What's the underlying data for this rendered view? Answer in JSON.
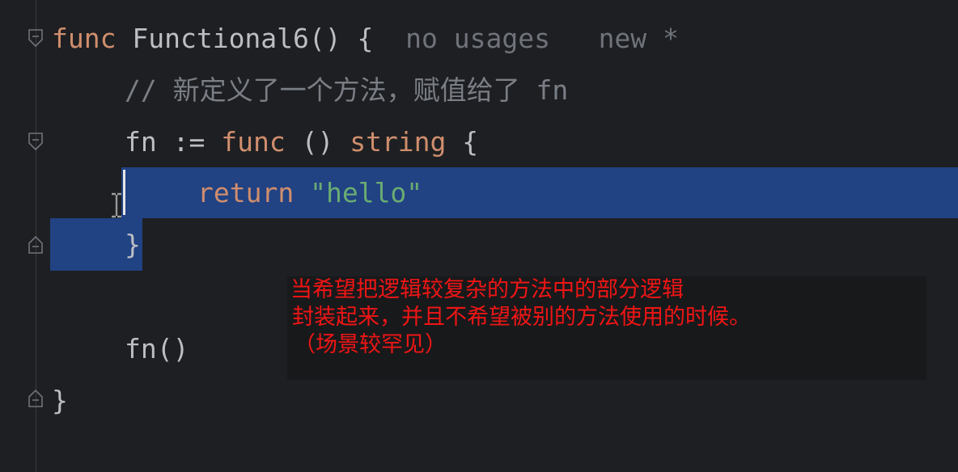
{
  "code": {
    "line1": {
      "keyword": "func",
      "name": "Functional6",
      "rest": "() {",
      "hint_usages": "no usages",
      "hint_new": "new *"
    },
    "line2": {
      "comment": "// 新定义了一个方法，赋值给了 fn"
    },
    "line3": {
      "var": "fn",
      "op": " := ",
      "keyword": "func",
      "parens": " () ",
      "type": "string",
      "brace": " {"
    },
    "line4": {
      "keyword": "return",
      "string": "\"hello\""
    },
    "line5": {
      "brace": "}"
    },
    "line6": {
      "call": "fn()"
    },
    "line7": {
      "brace": "}"
    }
  },
  "annotation": {
    "line1": "当希望把逻辑较复杂的方法中的部分逻辑",
    "line2": "封装起来，并且不希望被别的方法使用的时候。",
    "line3": "（场景较罕见）"
  },
  "colors": {
    "background": "#1e1f22",
    "keyword": "#cf8e6d",
    "string": "#6aab73",
    "comment": "#7a7e85",
    "selection": "#214283",
    "annotation_text": "#f01515"
  }
}
